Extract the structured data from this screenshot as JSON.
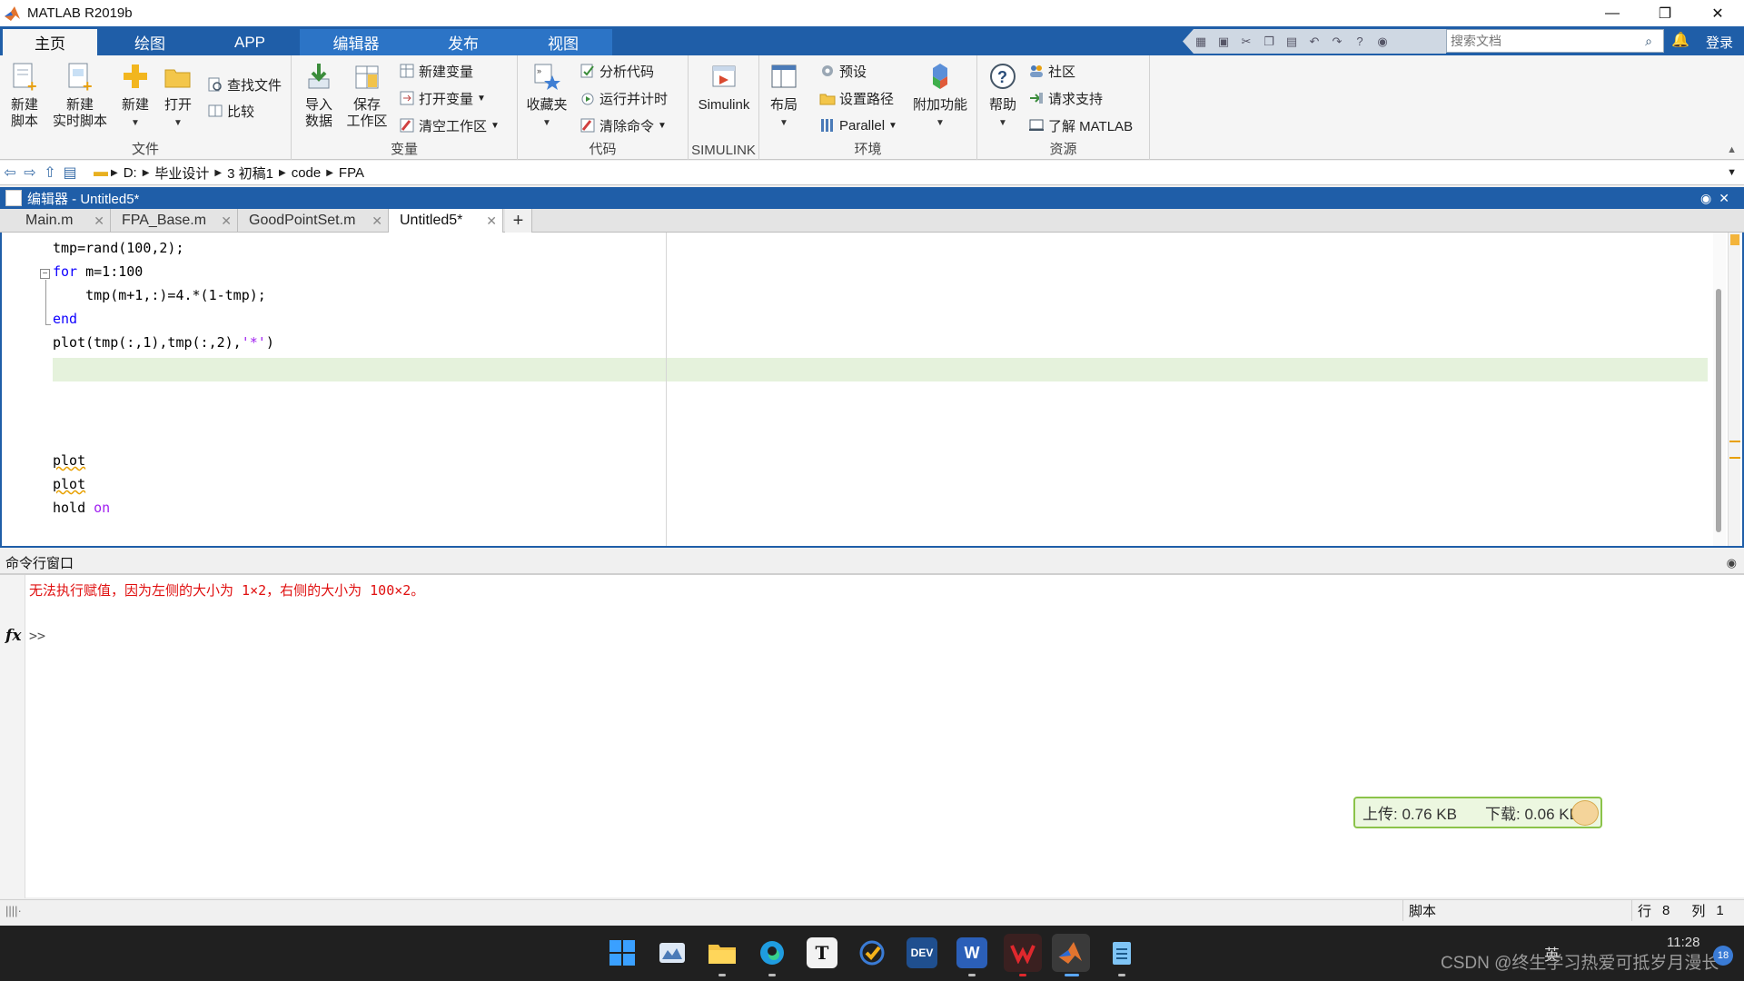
{
  "window": {
    "title": "MATLAB R2019b",
    "controls": [
      "—",
      "❐",
      "✕"
    ]
  },
  "ribbon_tabs": [
    "主页",
    "绘图",
    "APP",
    "编辑器",
    "发布",
    "视图"
  ],
  "search": {
    "placeholder": "搜索文档",
    "login": "登录"
  },
  "groups": {
    "file": {
      "label": "文件",
      "new_script_l1": "新建",
      "new_script_l2": "脚本",
      "new_live_l1": "新建",
      "new_live_l2": "实时脚本",
      "new": "新建",
      "open": "打开",
      "find_files": "查找文件",
      "compare": "比较"
    },
    "variable": {
      "label": "变量",
      "import_l1": "导入",
      "import_l2": "数据",
      "save_l1": "保存",
      "save_l2": "工作区",
      "new_var": "新建变量",
      "open_var": "打开变量",
      "clear_ws": "清空工作区"
    },
    "code": {
      "label": "代码",
      "favorites": "收藏夹",
      "analyze": "分析代码",
      "run_time": "运行并计时",
      "clear_cmds": "清除命令"
    },
    "simulink": {
      "label": "SIMULINK",
      "simulink": "Simulink"
    },
    "env": {
      "label": "环境",
      "layout": "布局",
      "prefs": "预设",
      "set_path": "设置路径",
      "parallel": "Parallel",
      "addons": "附加功能"
    },
    "resources": {
      "label": "资源",
      "help": "帮助",
      "community": "社区",
      "support": "请求支持",
      "learn": "了解 MATLAB"
    }
  },
  "path": [
    "D:",
    "毕业设计",
    "3 初稿1",
    "code",
    "FPA"
  ],
  "editor": {
    "title": "编辑器 - Untitled5*",
    "tabs": [
      "Main.m",
      "FPA_Base.m",
      "GoodPointSet.m",
      "Untitled5*"
    ],
    "plus": "+",
    "lines": {
      "l1": "tmp=rand(100,2);",
      "l2_kw": "for",
      "l2_rest": " m=1:100",
      "l3": "    tmp(m+1,:)=4.*(1-tmp);",
      "l4_kw": "end",
      "l5_a": "plot(tmp(:,1),tmp(:,2),",
      "l5_str": "'*'",
      "l5_b": ")",
      "l6": "plot",
      "l7": "plot",
      "l8_a": "hold ",
      "l8_kw": "on"
    }
  },
  "command_window": {
    "title": "命令行窗口",
    "error": "无法执行赋值，因为左侧的大小为 1×2，右侧的大小为 100×2。",
    "fx": "fx",
    "prompt": ">>"
  },
  "net_speed": {
    "upload": "上传: 0.76 KB",
    "download": "下载: 0.06 KB"
  },
  "status": {
    "mode": "脚本",
    "row_label": "行",
    "row": "8",
    "col_label": "列",
    "col": "1"
  },
  "taskbar": {
    "watermark": "CSDN @终生学习热爱可抵岁月漫长",
    "lang": "英",
    "time": "11:28",
    "badge": "18",
    "dev_label": "DEV",
    "t_label": "T",
    "w_label": "W"
  },
  "colors": {
    "accent": "#1f5ea8",
    "error": "#e01010",
    "keyword": "#0e00ff",
    "string": "#a020f0",
    "current_line": "#e5f2dc"
  }
}
